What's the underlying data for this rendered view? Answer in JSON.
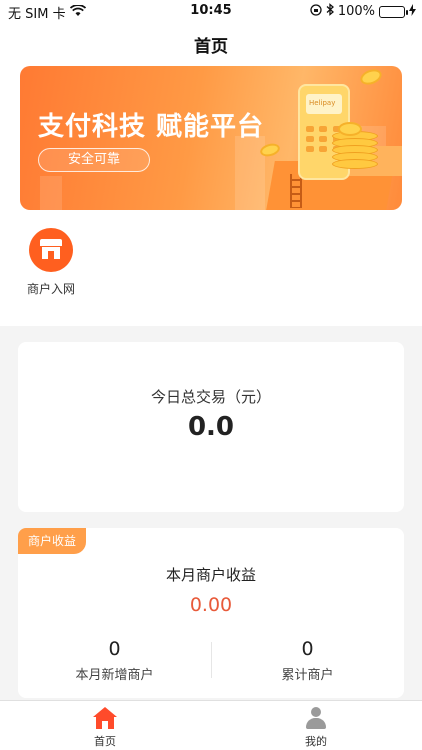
{
  "status_bar": {
    "carrier": "无 SIM 卡",
    "time": "10:45",
    "battery": "100%"
  },
  "header": {
    "title": "首页"
  },
  "banner": {
    "title": "支付科技 赋能平台",
    "subtitle": "安全可靠",
    "brand": "Helipay"
  },
  "menu": [
    {
      "label": "商户入网",
      "icon": "shop-icon"
    }
  ],
  "transaction": {
    "label": "今日总交易（元）",
    "value": "0.0"
  },
  "merchant_income": {
    "tag": "商户收益",
    "title": "本月商户收益",
    "amount": "0.00",
    "stats": [
      {
        "value": "0",
        "label": "本月新增商户"
      },
      {
        "value": "0",
        "label": "累计商户"
      }
    ]
  },
  "tabbar": {
    "items": [
      {
        "label": "首页",
        "icon": "home-icon",
        "active": true
      },
      {
        "label": "我的",
        "icon": "user-icon",
        "active": false
      }
    ]
  },
  "colors": {
    "accent": "#ff5f1f",
    "amount": "#e85a3a",
    "active_tab": "#ff4b2b",
    "tag": "#ff9f4a"
  }
}
